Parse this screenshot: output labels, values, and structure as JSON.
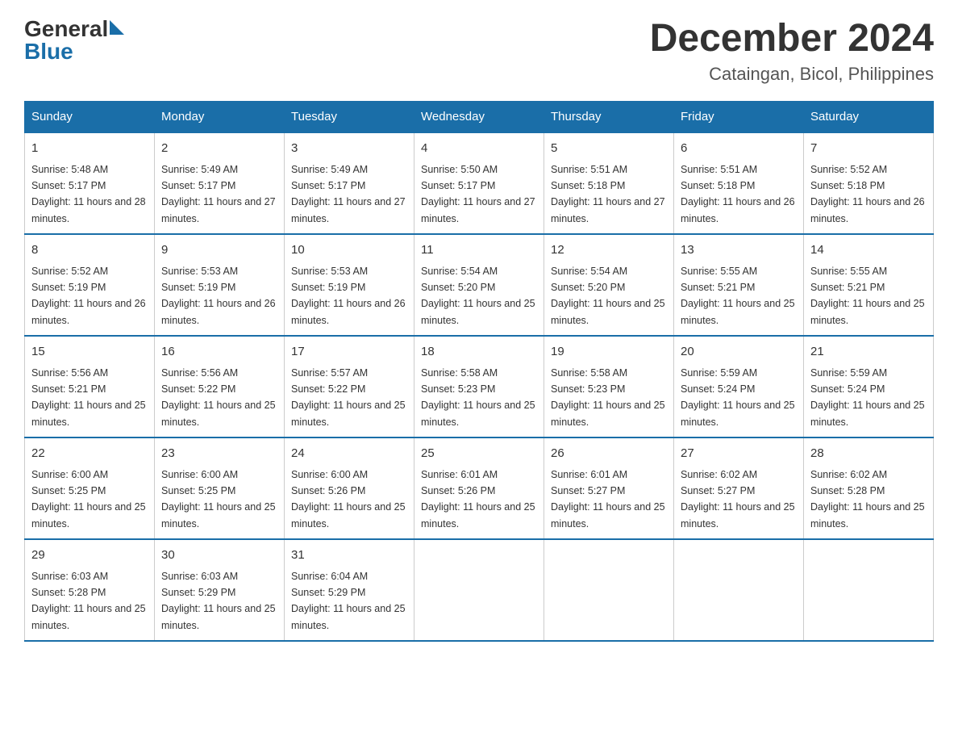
{
  "logo": {
    "general": "General",
    "blue": "Blue"
  },
  "title": {
    "month": "December 2024",
    "location": "Cataingan, Bicol, Philippines"
  },
  "weekdays": [
    "Sunday",
    "Monday",
    "Tuesday",
    "Wednesday",
    "Thursday",
    "Friday",
    "Saturday"
  ],
  "weeks": [
    [
      {
        "day": "1",
        "sunrise": "5:48 AM",
        "sunset": "5:17 PM",
        "daylight": "11 hours and 28 minutes."
      },
      {
        "day": "2",
        "sunrise": "5:49 AM",
        "sunset": "5:17 PM",
        "daylight": "11 hours and 27 minutes."
      },
      {
        "day": "3",
        "sunrise": "5:49 AM",
        "sunset": "5:17 PM",
        "daylight": "11 hours and 27 minutes."
      },
      {
        "day": "4",
        "sunrise": "5:50 AM",
        "sunset": "5:17 PM",
        "daylight": "11 hours and 27 minutes."
      },
      {
        "day": "5",
        "sunrise": "5:51 AM",
        "sunset": "5:18 PM",
        "daylight": "11 hours and 27 minutes."
      },
      {
        "day": "6",
        "sunrise": "5:51 AM",
        "sunset": "5:18 PM",
        "daylight": "11 hours and 26 minutes."
      },
      {
        "day": "7",
        "sunrise": "5:52 AM",
        "sunset": "5:18 PM",
        "daylight": "11 hours and 26 minutes."
      }
    ],
    [
      {
        "day": "8",
        "sunrise": "5:52 AM",
        "sunset": "5:19 PM",
        "daylight": "11 hours and 26 minutes."
      },
      {
        "day": "9",
        "sunrise": "5:53 AM",
        "sunset": "5:19 PM",
        "daylight": "11 hours and 26 minutes."
      },
      {
        "day": "10",
        "sunrise": "5:53 AM",
        "sunset": "5:19 PM",
        "daylight": "11 hours and 26 minutes."
      },
      {
        "day": "11",
        "sunrise": "5:54 AM",
        "sunset": "5:20 PM",
        "daylight": "11 hours and 25 minutes."
      },
      {
        "day": "12",
        "sunrise": "5:54 AM",
        "sunset": "5:20 PM",
        "daylight": "11 hours and 25 minutes."
      },
      {
        "day": "13",
        "sunrise": "5:55 AM",
        "sunset": "5:21 PM",
        "daylight": "11 hours and 25 minutes."
      },
      {
        "day": "14",
        "sunrise": "5:55 AM",
        "sunset": "5:21 PM",
        "daylight": "11 hours and 25 minutes."
      }
    ],
    [
      {
        "day": "15",
        "sunrise": "5:56 AM",
        "sunset": "5:21 PM",
        "daylight": "11 hours and 25 minutes."
      },
      {
        "day": "16",
        "sunrise": "5:56 AM",
        "sunset": "5:22 PM",
        "daylight": "11 hours and 25 minutes."
      },
      {
        "day": "17",
        "sunrise": "5:57 AM",
        "sunset": "5:22 PM",
        "daylight": "11 hours and 25 minutes."
      },
      {
        "day": "18",
        "sunrise": "5:58 AM",
        "sunset": "5:23 PM",
        "daylight": "11 hours and 25 minutes."
      },
      {
        "day": "19",
        "sunrise": "5:58 AM",
        "sunset": "5:23 PM",
        "daylight": "11 hours and 25 minutes."
      },
      {
        "day": "20",
        "sunrise": "5:59 AM",
        "sunset": "5:24 PM",
        "daylight": "11 hours and 25 minutes."
      },
      {
        "day": "21",
        "sunrise": "5:59 AM",
        "sunset": "5:24 PM",
        "daylight": "11 hours and 25 minutes."
      }
    ],
    [
      {
        "day": "22",
        "sunrise": "6:00 AM",
        "sunset": "5:25 PM",
        "daylight": "11 hours and 25 minutes."
      },
      {
        "day": "23",
        "sunrise": "6:00 AM",
        "sunset": "5:25 PM",
        "daylight": "11 hours and 25 minutes."
      },
      {
        "day": "24",
        "sunrise": "6:00 AM",
        "sunset": "5:26 PM",
        "daylight": "11 hours and 25 minutes."
      },
      {
        "day": "25",
        "sunrise": "6:01 AM",
        "sunset": "5:26 PM",
        "daylight": "11 hours and 25 minutes."
      },
      {
        "day": "26",
        "sunrise": "6:01 AM",
        "sunset": "5:27 PM",
        "daylight": "11 hours and 25 minutes."
      },
      {
        "day": "27",
        "sunrise": "6:02 AM",
        "sunset": "5:27 PM",
        "daylight": "11 hours and 25 minutes."
      },
      {
        "day": "28",
        "sunrise": "6:02 AM",
        "sunset": "5:28 PM",
        "daylight": "11 hours and 25 minutes."
      }
    ],
    [
      {
        "day": "29",
        "sunrise": "6:03 AM",
        "sunset": "5:28 PM",
        "daylight": "11 hours and 25 minutes."
      },
      {
        "day": "30",
        "sunrise": "6:03 AM",
        "sunset": "5:29 PM",
        "daylight": "11 hours and 25 minutes."
      },
      {
        "day": "31",
        "sunrise": "6:04 AM",
        "sunset": "5:29 PM",
        "daylight": "11 hours and 25 minutes."
      },
      null,
      null,
      null,
      null
    ]
  ]
}
